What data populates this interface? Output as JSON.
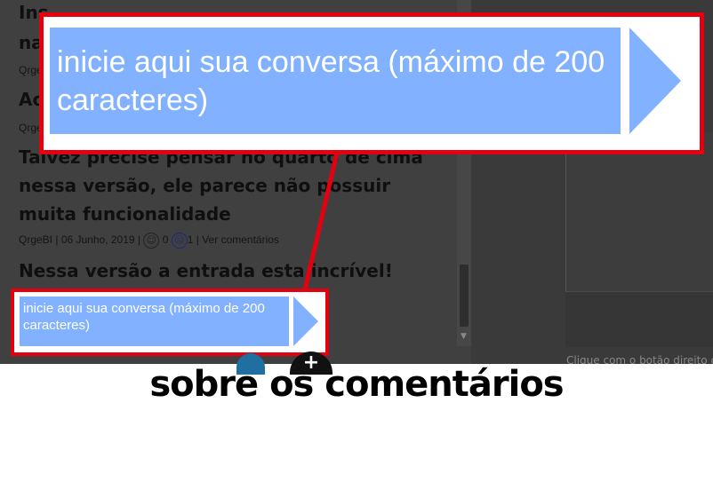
{
  "comments": [
    {
      "title": "na",
      "meta": "QrgeBI"
    },
    {
      "title": "Ac",
      "meta": "QrgeBI"
    },
    {
      "title": "Talvez precise pensar no quarto de cima nessa versão, ele parece não possuir muita funcionalidade",
      "meta_author": "QrgeBI",
      "meta_date": "06 Junho, 2019",
      "likes": "0",
      "dislikes": "1",
      "view_comments": "Ver comentários"
    },
    {
      "title": "Nessa versão a entrada esta incrível!"
    }
  ],
  "chat": {
    "placeholder": "inicie aqui sua conversa (máximo de 200 caracteres)"
  },
  "zoom": {
    "placeholder": "inicie aqui sua conversa (máximo de 200 caracteres)"
  },
  "footer": {
    "text": "Clique com o botão direito do m"
  },
  "icons": {
    "smile": "smile-icon",
    "sad": "sad-face-icon",
    "send": "send-arrow-icon",
    "plus": "plus-icon"
  },
  "colors": {
    "highlight": "#e4000f",
    "input_bg": "#82b1ff"
  },
  "caption": "sobre os comentários"
}
